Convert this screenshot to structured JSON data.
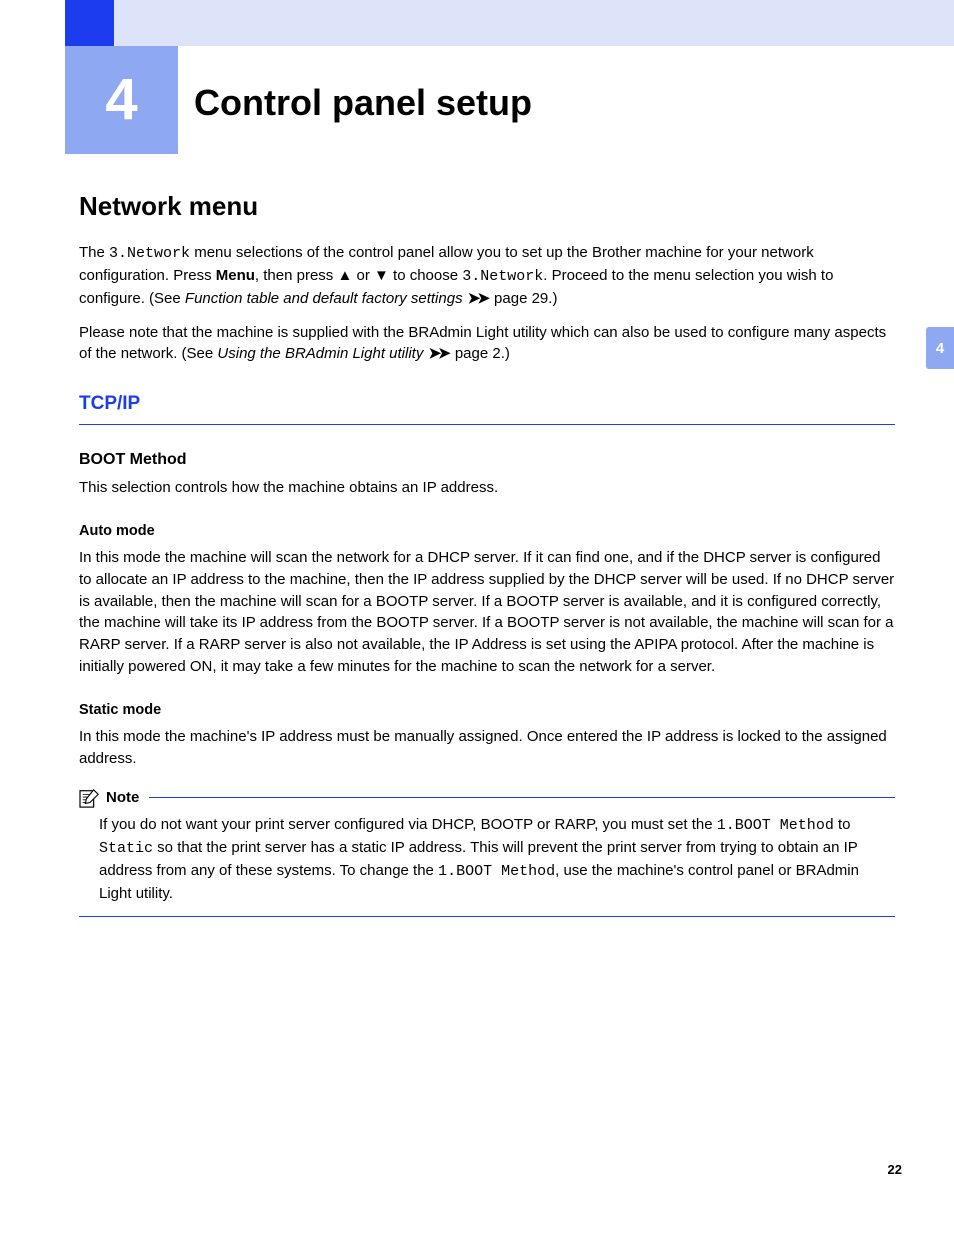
{
  "chapter": {
    "number": "4",
    "title": "Control panel setup"
  },
  "sideTab": "4",
  "pageNumber": "22",
  "section": {
    "heading": "Network menu",
    "para1_a": "The ",
    "para1_mono1": "3.Network",
    "para1_b": " menu selections of the control panel allow you to set up the Brother machine for your network configuration. Press ",
    "para1_bold1": "Menu",
    "para1_c": ", then press ",
    "para1_up": "▲",
    "para1_d": " or ",
    "para1_down": "▼",
    "para1_e": " to choose ",
    "para1_mono2": "3.Network",
    "para1_f": ". Proceed to the menu selection you wish to configure. (See ",
    "para1_italic1": "Function table and default factory settings",
    "para1_arrow": "➤➤",
    "para1_g": " page 29.)",
    "para2_a": "Please note that the machine is supplied with the BRAdmin Light utility which can also be used to configure many aspects of the network. (See ",
    "para2_italic1": "Using the BRAdmin Light utility",
    "para2_arrow": "➤➤",
    "para2_b": " page 2.)"
  },
  "tcpip": {
    "heading": "TCP/IP",
    "boot": {
      "heading": "BOOT Method",
      "desc": "This selection controls how the machine obtains an IP address."
    },
    "auto": {
      "heading": "Auto mode",
      "body": "In this mode the machine will scan the network for a DHCP server. If it can find one, and if the DHCP server is configured to allocate an IP address to the machine, then the IP address supplied by the DHCP server will be used. If no DHCP server is available, then the machine will scan for a BOOTP server. If a BOOTP server is available, and it is configured correctly, the machine will take its IP address from the BOOTP server. If a BOOTP server is not available, the machine will scan for a RARP server. If a RARP server is also not available, the IP Address is set using the APIPA protocol. After the machine is initially powered ON, it may take a few minutes for the machine to scan the network for a server."
    },
    "static": {
      "heading": "Static mode",
      "body": "In this mode the machine's IP address must be manually assigned. Once entered the IP address is locked to the assigned address."
    },
    "note": {
      "label": "Note",
      "body_a": "If you do not want your print server configured via DHCP, BOOTP or RARP, you must set the ",
      "body_mono1": "1.BOOT Method",
      "body_b": " to ",
      "body_mono2": "Static",
      "body_c": " so that the print server has a static IP address. This will prevent the print server from trying to obtain an IP address from any of these systems. To change the ",
      "body_mono3": "1.BOOT Method",
      "body_d": ", use the machine's control panel or BRAdmin Light utility."
    }
  }
}
